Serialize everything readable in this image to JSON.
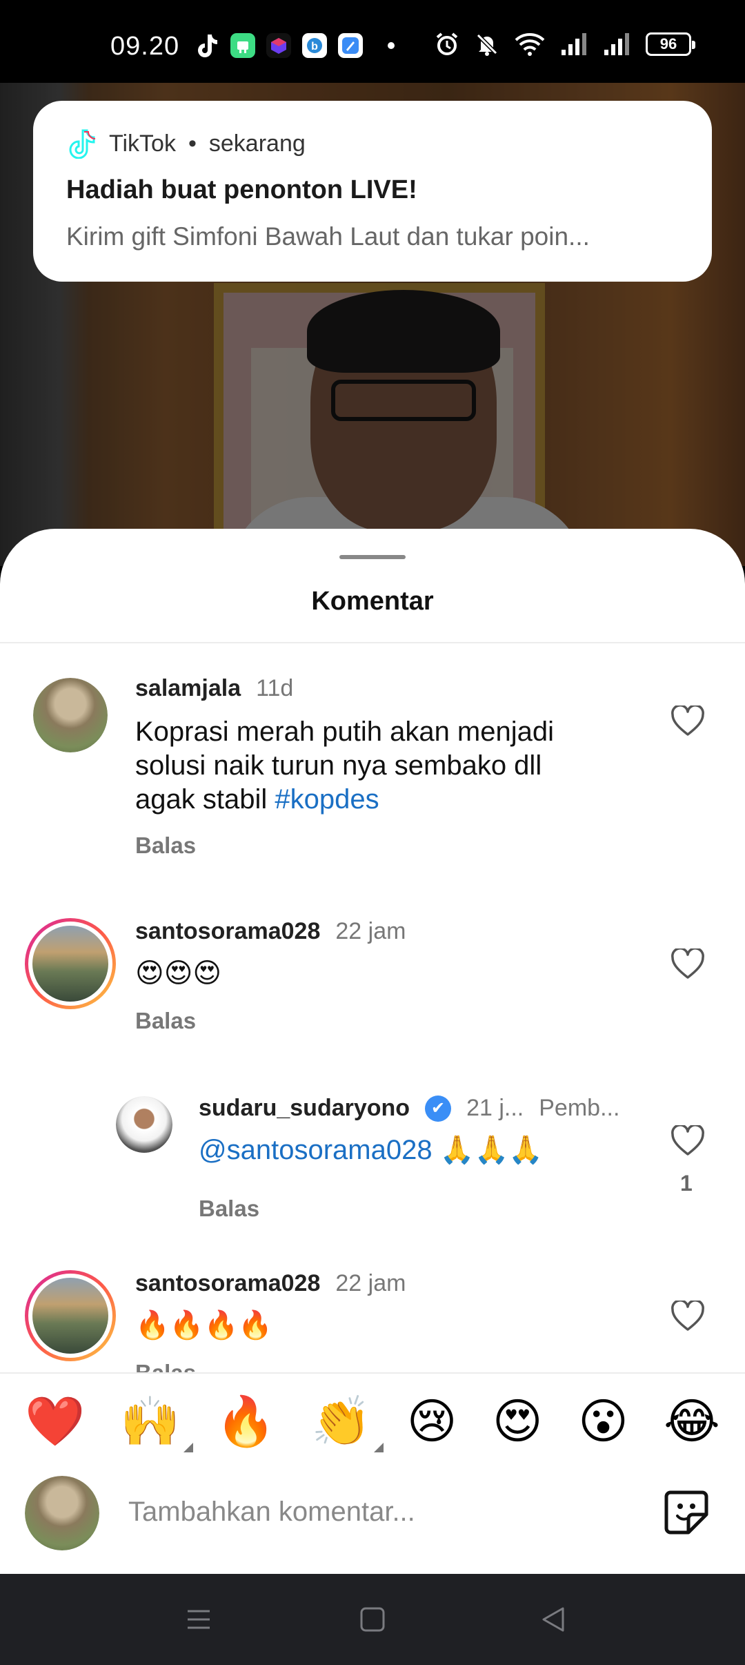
{
  "status_bar": {
    "time": "09.20",
    "battery": "96",
    "icons": [
      "tiktok-icon",
      "android-app-icon",
      "app-cube-icon",
      "app-b-icon",
      "app-blue-icon",
      "alarm-icon",
      "mute-icon",
      "wifi-icon",
      "signal-icon",
      "signal-icon"
    ]
  },
  "notification": {
    "app": "TikTok",
    "time": "sekarang",
    "separator": "•",
    "title": "Hadiah buat penonton LIVE!",
    "body": "Kirim gift Simfoni Bawah Laut dan tukar poin..."
  },
  "sheet": {
    "title": "Komentar"
  },
  "comments": [
    {
      "user": "salamjala",
      "time": "11d",
      "text": "Koprasi merah putih akan menjadi solusi naik turun nya sembako dll agak stabil ",
      "tag": "#kopdes",
      "reply": "Balas"
    },
    {
      "user": "santosorama028",
      "time": "22 jam",
      "text": "😍😍😍",
      "reply": "Balas"
    },
    {
      "user": "sudaru_sudaryono",
      "verified": "✔",
      "time": "21 j...",
      "role": "Pemb...",
      "mention": "@santosorama028",
      "text": " 🙏🙏🙏",
      "reply": "Balas",
      "likes": "1"
    },
    {
      "user": "santosorama028",
      "time": "22 jam",
      "text": "🔥🔥🔥🔥",
      "reply": "Balas"
    }
  ],
  "emoji_bar": [
    "❤️",
    "🙌",
    "🔥",
    "👏",
    "😢",
    "😍",
    "😮",
    "😂"
  ],
  "input": {
    "placeholder": "Tambahkan komentar..."
  },
  "colors": {
    "tag": "#1a6fc4",
    "ring_start": "#d6249f",
    "ring_end": "#fdca40",
    "nav_bg": "#1f2024"
  }
}
